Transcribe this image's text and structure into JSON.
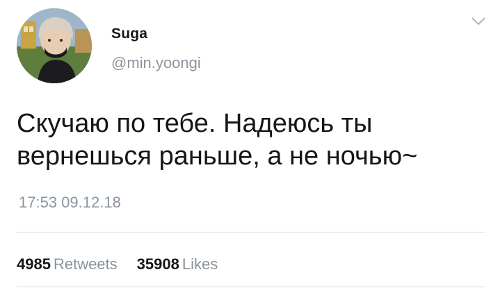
{
  "author": {
    "display_name": "Suga",
    "handle": "@min.yoongi"
  },
  "tweet": {
    "text": "Скучаю по тебе. Надеюсь ты\nвернешься раньше,  а не ночью~",
    "timestamp": "17:53 09.12.18"
  },
  "stats": {
    "retweets_count": "4985",
    "retweets_label": "Retweets",
    "likes_count": "35908",
    "likes_label": "Likes"
  },
  "icons": {
    "menu": "chevron-down-icon"
  },
  "colors": {
    "text": "#14171a",
    "secondary_text": "#8a949d",
    "divider": "#d3d9de"
  }
}
